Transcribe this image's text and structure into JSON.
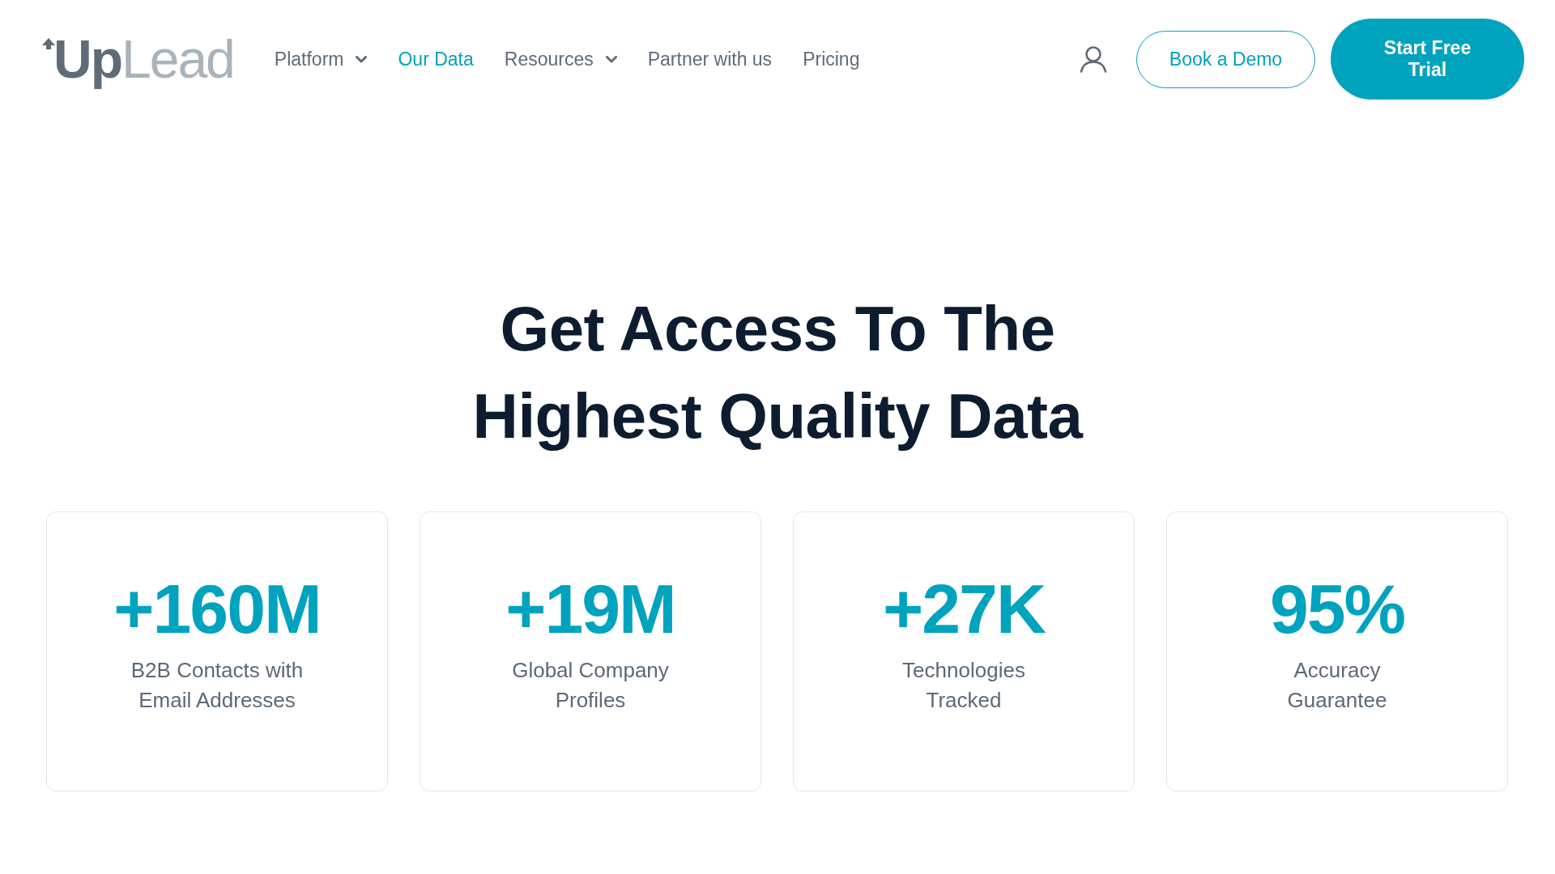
{
  "header": {
    "logo": {
      "strong": "Up",
      "light": "Lead"
    },
    "nav": [
      {
        "label": "Platform",
        "selected": false,
        "dropdown": true
      },
      {
        "label": "Our Data",
        "selected": true,
        "dropdown": false
      },
      {
        "label": "Resources",
        "selected": false,
        "dropdown": true
      },
      {
        "label": "Partner with us",
        "selected": false,
        "dropdown": false
      },
      {
        "label": "Pricing",
        "selected": false,
        "dropdown": false
      }
    ],
    "buttons": [
      {
        "kind": "outline",
        "label_lines": [
          "Book a Demo"
        ]
      },
      {
        "kind": "filled",
        "label_lines": [
          "Start Free",
          "Trial"
        ]
      }
    ]
  },
  "hero": {
    "title_lines": [
      "Get Access To The",
      "Highest Quality Data"
    ]
  },
  "stats": [
    {
      "value": "+160M",
      "label_lines": [
        "B2B Contacts with",
        "Email Addresses"
      ]
    },
    {
      "value": "+19M",
      "label_lines": [
        "Global Company",
        "Profiles"
      ]
    },
    {
      "value": "+27K",
      "label_lines": [
        "Technologies",
        "Tracked"
      ]
    },
    {
      "value": "95%",
      "label_lines": [
        "Accuracy",
        "Guarantee"
      ]
    }
  ]
}
